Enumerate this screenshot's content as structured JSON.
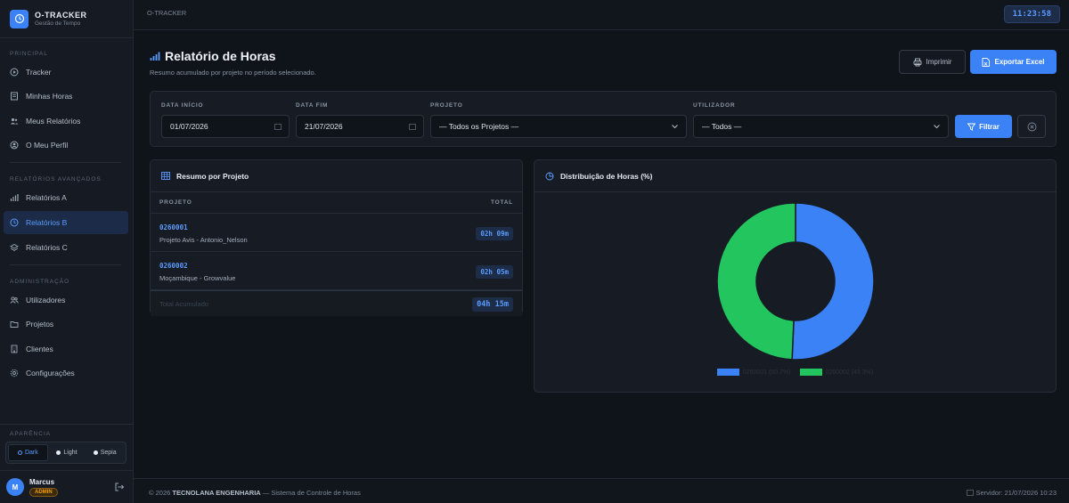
{
  "brand": {
    "name": "O-TRACKER",
    "subtitle": "Gestão de Tempo"
  },
  "sidebar": {
    "sections": [
      {
        "label": "PRINCIPAL"
      },
      {
        "label": "RELATÓRIOS AVANÇADOS"
      },
      {
        "label": "ADMINISTRAÇÃO"
      }
    ],
    "items": [
      {
        "label": "Tracker",
        "icon": "play-circle-icon"
      },
      {
        "label": "Minhas Horas",
        "icon": "document-icon"
      },
      {
        "label": "Meus Relatórios",
        "icon": "users-icon"
      },
      {
        "label": "O Meu Perfil",
        "icon": "user-circle-icon"
      },
      {
        "label": "Relatórios A",
        "icon": "bar-chart-icon"
      },
      {
        "label": "Relatórios B",
        "icon": "clock-icon",
        "active": true
      },
      {
        "label": "Relatórios C",
        "icon": "layers-icon"
      },
      {
        "label": "Utilizadores",
        "icon": "users-group-icon"
      },
      {
        "label": "Projetos",
        "icon": "folder-icon"
      },
      {
        "label": "Clientes",
        "icon": "building-icon"
      },
      {
        "label": "Configurações",
        "icon": "gear-icon"
      }
    ],
    "appearance_label": "APARÊNCIA",
    "themes": [
      {
        "label": "Dark",
        "active": true
      },
      {
        "label": "Light"
      },
      {
        "label": "Sepia"
      }
    ],
    "user": {
      "initial": "M",
      "name": "Marcus",
      "role": "ADMIN"
    }
  },
  "topbar": {
    "breadcrumb": "O-TRACKER",
    "clock": "11:23:58"
  },
  "page": {
    "title": "Relatório de Horas",
    "subtitle": "Resumo acumulado por projeto no período selecionado.",
    "print_label": "Imprimir",
    "export_label": "Exportar Excel"
  },
  "filters": {
    "start_label": "DATA INÍCIO",
    "start_value": "01/07/2026",
    "end_label": "DATA FIM",
    "end_value": "21/07/2026",
    "project_label": "PROJETO",
    "project_value": "— Todos os Projetos —",
    "user_label": "UTILIZADOR",
    "user_value": "— Todos —",
    "filter_label": "Filtrar"
  },
  "summary": {
    "title": "Resumo por Projeto",
    "col_project": "PROJETO",
    "col_total": "TOTAL",
    "rows": [
      {
        "code": "0260001",
        "name": "Projeto Avis - Antonio_Nelson",
        "total": "02h 09m"
      },
      {
        "code": "0260002",
        "name": "Moçambique - Growvalue",
        "total": "02h 05m"
      }
    ],
    "total_label": "Total Acumulado",
    "total_value": "04h 15m"
  },
  "distribution": {
    "title": "Distribuição de Horas (%)"
  },
  "chart_data": {
    "type": "pie",
    "categories": [
      "0260001 (50.7%)",
      "0260002 (49.3%)"
    ],
    "values": [
      50.7,
      49.3
    ],
    "colors": [
      "#3b82f6",
      "#22c55e"
    ],
    "legend": "bottom"
  },
  "footer": {
    "year": "© 2026",
    "company": "TECNOLANA ENGENHARIA",
    "system": "— Sistema de Controle de Horas",
    "server": "Servidor: 21/07/2026 10:23"
  }
}
